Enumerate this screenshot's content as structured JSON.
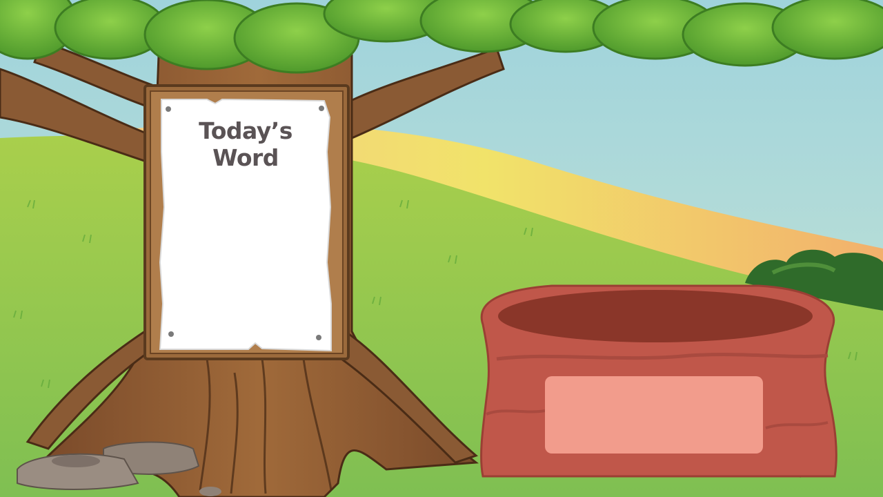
{
  "board": {
    "title": "Today’s Word"
  },
  "sack": {
    "label": ""
  },
  "colors": {
    "sky": "#a8d9dc",
    "grass": "#8cc152",
    "trunk": "#8a5a34",
    "leaves": "#68b83c",
    "sack": "#c0574a",
    "sack_label": "#f29c8c",
    "title_text": "#5a5355"
  }
}
